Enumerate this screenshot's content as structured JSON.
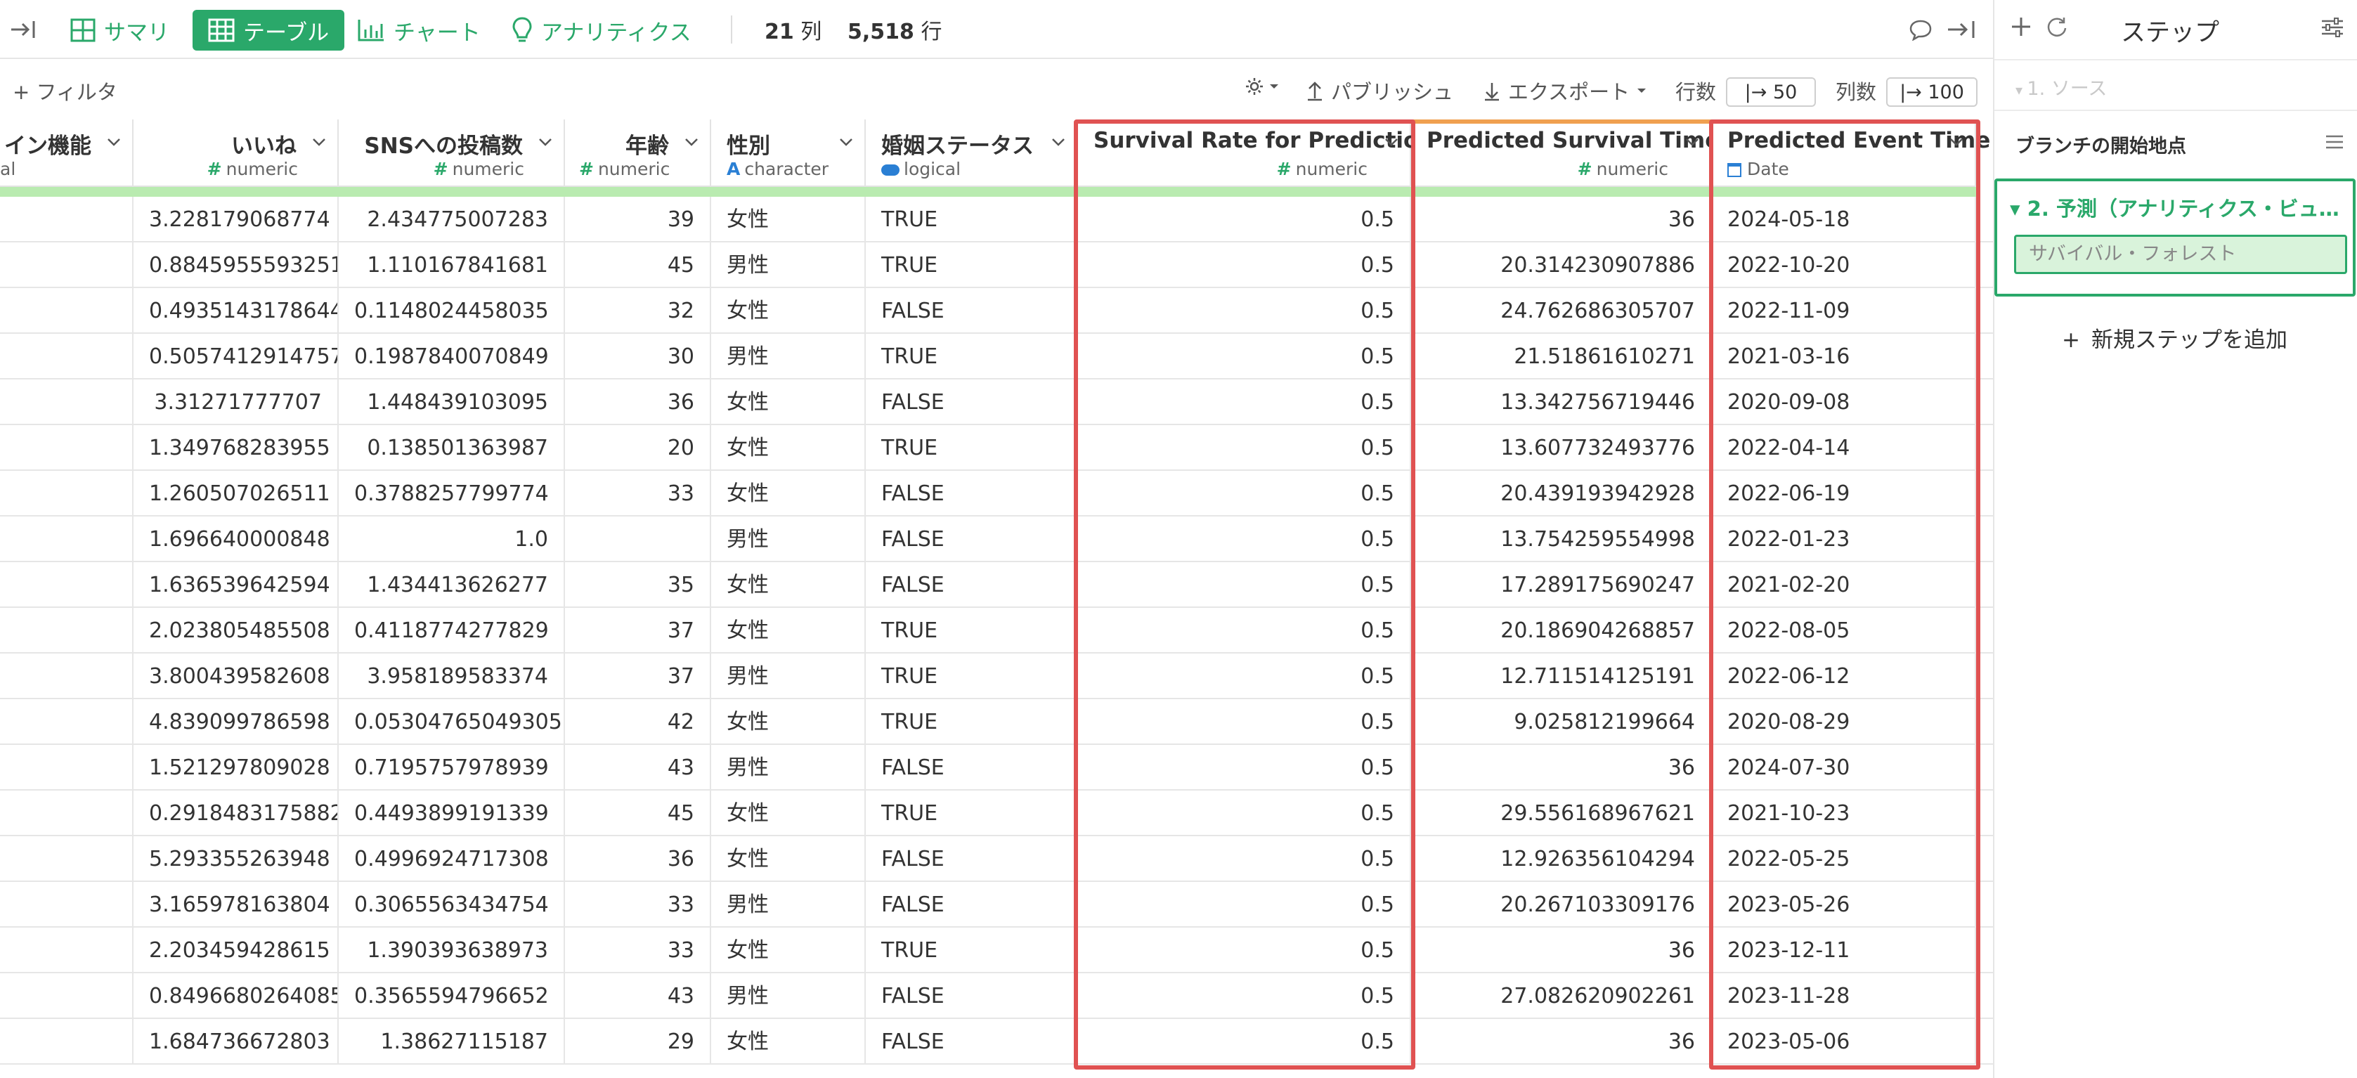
{
  "toolbar": {
    "tabs": [
      {
        "label": "サマリ",
        "icon": "grid-icon"
      },
      {
        "label": "テーブル",
        "icon": "table-icon"
      },
      {
        "label": "チャート",
        "icon": "bar-chart-icon"
      },
      {
        "label": "アナリティクス",
        "icon": "bulb-icon"
      }
    ],
    "cols_count": "21",
    "cols_unit": "列",
    "rows_count": "5,518",
    "rows_unit": "行"
  },
  "subbar": {
    "filter_label": "+ フィルタ",
    "publish_label": "パブリッシュ",
    "export_label": "エクスポート",
    "rows_label": "行数",
    "rows_value": "|→ 50",
    "cols_label": "列数",
    "cols_value": "|→ 100"
  },
  "columns": [
    {
      "name": "イン機能",
      "type": "al",
      "kind": "text"
    },
    {
      "name": "いいね",
      "type": "numeric",
      "kind": "num"
    },
    {
      "name": "SNSへの投稿数",
      "type": "numeric",
      "kind": "num"
    },
    {
      "name": "年齢",
      "type": "numeric",
      "kind": "num"
    },
    {
      "name": "性別",
      "type": "character",
      "kind": "text"
    },
    {
      "name": "婚姻ステータス",
      "type": "logical",
      "kind": "text"
    },
    {
      "name": "Survival Rate for Prediction",
      "type": "numeric",
      "kind": "num"
    },
    {
      "name": "Predicted Survival Time",
      "type": "numeric",
      "kind": "num"
    },
    {
      "name": "Predicted Event Time",
      "type": "Date",
      "kind": "text"
    }
  ],
  "rows": [
    [
      "",
      "3.228179068774",
      "2.434775007283",
      "39",
      "女性",
      "TRUE",
      "0.5",
      "36",
      "2024-05-18"
    ],
    [
      "",
      "0.8845955593251",
      "1.110167841681",
      "45",
      "男性",
      "TRUE",
      "0.5",
      "20.314230907886",
      "2022-10-20"
    ],
    [
      "",
      "0.4935143178644",
      "0.1148024458035",
      "32",
      "女性",
      "FALSE",
      "0.5",
      "24.762686305707",
      "2022-11-09"
    ],
    [
      "",
      "0.5057412914757",
      "0.1987840070849",
      "30",
      "男性",
      "TRUE",
      "0.5",
      "21.51861610271",
      "2021-03-16"
    ],
    [
      "",
      "3.31271777707",
      "1.448439103095",
      "36",
      "女性",
      "FALSE",
      "0.5",
      "13.342756719446",
      "2020-09-08"
    ],
    [
      "",
      "1.349768283955",
      "0.138501363987",
      "20",
      "女性",
      "TRUE",
      "0.5",
      "13.607732493776",
      "2022-04-14"
    ],
    [
      "",
      "1.260507026511",
      "0.3788257799774",
      "33",
      "女性",
      "FALSE",
      "0.5",
      "20.439193942928",
      "2022-06-19"
    ],
    [
      "",
      "1.696640000848",
      "1.0",
      "",
      "男性",
      "FALSE",
      "0.5",
      "13.754259554998",
      "2022-01-23"
    ],
    [
      "",
      "1.636539642594",
      "1.434413626277",
      "35",
      "女性",
      "FALSE",
      "0.5",
      "17.289175690247",
      "2021-02-20"
    ],
    [
      "",
      "2.023805485508",
      "0.4118774277829",
      "37",
      "女性",
      "TRUE",
      "0.5",
      "20.186904268857",
      "2022-08-05"
    ],
    [
      "",
      "3.800439582608",
      "3.958189583374",
      "37",
      "男性",
      "TRUE",
      "0.5",
      "12.711514125191",
      "2022-06-12"
    ],
    [
      "",
      "4.839099786598",
      "0.05304765049305",
      "42",
      "女性",
      "TRUE",
      "0.5",
      "9.025812199664",
      "2020-08-29"
    ],
    [
      "",
      "1.521297809028",
      "0.7195757978939",
      "43",
      "男性",
      "FALSE",
      "0.5",
      "36",
      "2024-07-30"
    ],
    [
      "",
      "0.2918483175882",
      "0.4493899191339",
      "45",
      "女性",
      "TRUE",
      "0.5",
      "29.556168967621",
      "2021-10-23"
    ],
    [
      "",
      "5.293355263948",
      "0.4996924717308",
      "36",
      "女性",
      "FALSE",
      "0.5",
      "12.926356104294",
      "2022-05-25"
    ],
    [
      "",
      "3.165978163804",
      "0.3065563434754",
      "33",
      "男性",
      "FALSE",
      "0.5",
      "20.267103309176",
      "2023-05-26"
    ],
    [
      "",
      "2.203459428615",
      "1.390393638973",
      "33",
      "女性",
      "TRUE",
      "0.5",
      "36",
      "2023-12-11"
    ],
    [
      "",
      "0.8496680264085",
      "0.3565594796652",
      "43",
      "男性",
      "FALSE",
      "0.5",
      "27.082620902261",
      "2023-11-28"
    ],
    [
      "",
      "1.684736672803",
      "1.38627115187",
      "29",
      "女性",
      "FALSE",
      "0.5",
      "36",
      "2023-05-06"
    ]
  ],
  "panel": {
    "title": "ステップ",
    "source_step": "1. ソース",
    "branch_label": "ブランチの開始地点",
    "active_step": "2. 予測（アナリティクス・ビュ…",
    "chip": "サバイバル・フォレスト",
    "add_step": "新規ステップを追加"
  },
  "colors": {
    "accent": "#2aa86a",
    "highlight": "#e05252",
    "header_bar": "#b9ebb0"
  }
}
